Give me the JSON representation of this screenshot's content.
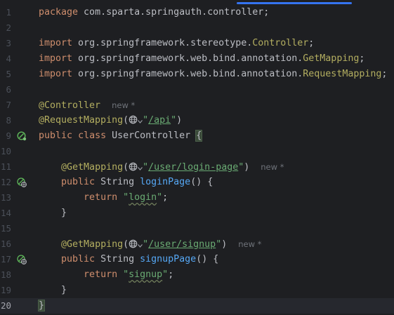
{
  "lines": [
    {
      "number": "1",
      "tokens": [
        {
          "text": "package",
          "kind": "kw"
        },
        {
          "text": " com.sparta.springauth.controller;",
          "kind": "plain"
        }
      ]
    },
    {
      "number": "2",
      "tokens": []
    },
    {
      "number": "3",
      "tokens": [
        {
          "text": "import",
          "kind": "kw"
        },
        {
          "text": " org.springframework.stereotype.",
          "kind": "plain"
        },
        {
          "text": "Controller",
          "kind": "cls"
        },
        {
          "text": ";",
          "kind": "plain"
        }
      ]
    },
    {
      "number": "4",
      "tokens": [
        {
          "text": "import",
          "kind": "kw"
        },
        {
          "text": " org.springframework.web.bind.annotation.",
          "kind": "plain"
        },
        {
          "text": "GetMapping",
          "kind": "cls"
        },
        {
          "text": ";",
          "kind": "plain"
        }
      ]
    },
    {
      "number": "5",
      "tokens": [
        {
          "text": "import",
          "kind": "kw"
        },
        {
          "text": " org.springframework.web.bind.annotation.",
          "kind": "plain"
        },
        {
          "text": "RequestMapping",
          "kind": "cls"
        },
        {
          "text": ";",
          "kind": "plain"
        }
      ]
    },
    {
      "number": "6",
      "tokens": []
    },
    {
      "number": "7",
      "tokens": [
        {
          "text": "@Controller",
          "kind": "ann"
        },
        {
          "text": "  ",
          "kind": "plain"
        },
        {
          "text": "new *",
          "kind": "hint"
        }
      ]
    },
    {
      "number": "8",
      "tokens": [
        {
          "text": "@RequestMapping",
          "kind": "ann"
        },
        {
          "text": "(",
          "kind": "plain"
        },
        {
          "text": "",
          "kind": "globe"
        },
        {
          "text": "\"",
          "kind": "str"
        },
        {
          "text": "/api",
          "kind": "str-link"
        },
        {
          "text": "\"",
          "kind": "str"
        },
        {
          "text": ")",
          "kind": "plain"
        }
      ]
    },
    {
      "number": "9",
      "mark": "bean",
      "tokens": [
        {
          "text": "public",
          "kind": "kw"
        },
        {
          "text": " ",
          "kind": "plain"
        },
        {
          "text": "class",
          "kind": "kw"
        },
        {
          "text": " UserController ",
          "kind": "plain"
        },
        {
          "text": "{",
          "kind": "brace-hl"
        }
      ]
    },
    {
      "number": "10",
      "tokens": []
    },
    {
      "number": "11",
      "tokens": [
        {
          "text": "    ",
          "kind": "plain"
        },
        {
          "text": "@GetMapping",
          "kind": "ann"
        },
        {
          "text": "(",
          "kind": "plain"
        },
        {
          "text": "",
          "kind": "globe"
        },
        {
          "text": "\"",
          "kind": "str"
        },
        {
          "text": "/user/login-page",
          "kind": "str-link"
        },
        {
          "text": "\"",
          "kind": "str"
        },
        {
          "text": ")",
          "kind": "plain"
        },
        {
          "text": "  ",
          "kind": "plain"
        },
        {
          "text": "new *",
          "kind": "hint"
        }
      ]
    },
    {
      "number": "12",
      "mark": "endpoint",
      "tokens": [
        {
          "text": "    ",
          "kind": "plain"
        },
        {
          "text": "public",
          "kind": "kw"
        },
        {
          "text": " String ",
          "kind": "plain"
        },
        {
          "text": "loginPage",
          "kind": "fn"
        },
        {
          "text": "() {",
          "kind": "plain"
        }
      ]
    },
    {
      "number": "13",
      "tokens": [
        {
          "text": "        ",
          "kind": "plain"
        },
        {
          "text": "return",
          "kind": "kw"
        },
        {
          "text": " ",
          "kind": "plain"
        },
        {
          "text": "\"",
          "kind": "str"
        },
        {
          "text": "login",
          "kind": "str-wavy"
        },
        {
          "text": "\"",
          "kind": "str"
        },
        {
          "text": ";",
          "kind": "plain"
        }
      ]
    },
    {
      "number": "14",
      "tokens": [
        {
          "text": "    }",
          "kind": "plain"
        }
      ]
    },
    {
      "number": "15",
      "tokens": []
    },
    {
      "number": "16",
      "tokens": [
        {
          "text": "    ",
          "kind": "plain"
        },
        {
          "text": "@GetMapping",
          "kind": "ann"
        },
        {
          "text": "(",
          "kind": "plain"
        },
        {
          "text": "",
          "kind": "globe"
        },
        {
          "text": "\"",
          "kind": "str"
        },
        {
          "text": "/user/signup",
          "kind": "str-link"
        },
        {
          "text": "\"",
          "kind": "str"
        },
        {
          "text": ")",
          "kind": "plain"
        },
        {
          "text": "  ",
          "kind": "plain"
        },
        {
          "text": "new *",
          "kind": "hint"
        }
      ]
    },
    {
      "number": "17",
      "mark": "endpoint",
      "tokens": [
        {
          "text": "    ",
          "kind": "plain"
        },
        {
          "text": "public",
          "kind": "kw"
        },
        {
          "text": " String ",
          "kind": "plain"
        },
        {
          "text": "signupPage",
          "kind": "fn"
        },
        {
          "text": "() {",
          "kind": "plain"
        }
      ]
    },
    {
      "number": "18",
      "tokens": [
        {
          "text": "        ",
          "kind": "plain"
        },
        {
          "text": "return",
          "kind": "kw"
        },
        {
          "text": " ",
          "kind": "plain"
        },
        {
          "text": "\"",
          "kind": "str"
        },
        {
          "text": "signup",
          "kind": "str-wavy"
        },
        {
          "text": "\"",
          "kind": "str"
        },
        {
          "text": ";",
          "kind": "plain"
        }
      ]
    },
    {
      "number": "19",
      "tokens": [
        {
          "text": "    }",
          "kind": "plain"
        }
      ]
    },
    {
      "number": "20",
      "current": true,
      "tokens": [
        {
          "text": "}",
          "kind": "brace-hl"
        }
      ]
    }
  ],
  "colors": {
    "background": "#1e1f22",
    "keyword": "#cf8e6d",
    "annotation": "#b3ae60",
    "string": "#6aab73",
    "method": "#56a8f5",
    "text": "#bcbec4",
    "line_number": "#4b5059",
    "accent": "#3574f0"
  },
  "icons": {
    "bean": "spring-bean-gutter-icon",
    "endpoint": "web-endpoint-gutter-icon",
    "globe": "globe-icon"
  }
}
